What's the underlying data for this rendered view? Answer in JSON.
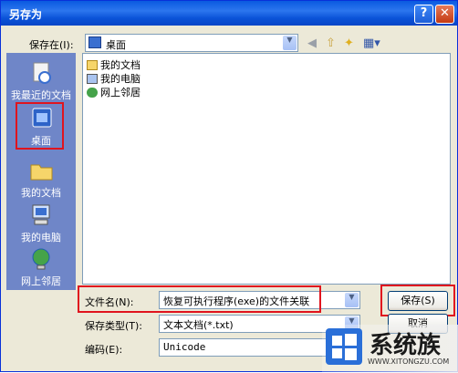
{
  "window": {
    "title": "另存为",
    "help": "?",
    "close": "✕"
  },
  "savein": {
    "label": "保存在(I):",
    "value": "桌面"
  },
  "places": [
    {
      "label": "我最近的文档",
      "icon": "recent-documents-icon"
    },
    {
      "label": "桌面",
      "icon": "desktop-icon"
    },
    {
      "label": "我的文档",
      "icon": "my-documents-icon"
    },
    {
      "label": "我的电脑",
      "icon": "my-computer-icon"
    },
    {
      "label": "网上邻居",
      "icon": "network-places-icon"
    }
  ],
  "files": [
    {
      "label": "我的文档",
      "icon": "folder-icon"
    },
    {
      "label": "我的电脑",
      "icon": "computer-icon"
    },
    {
      "label": "网上邻居",
      "icon": "network-icon"
    }
  ],
  "form": {
    "filename_label": "文件名(N):",
    "filename_value": "恢复可执行程序(exe)的文件关联",
    "type_label": "保存类型(T):",
    "type_value": "文本文档(*.txt)",
    "encoding_label": "编码(E):",
    "encoding_value": "Unicode"
  },
  "buttons": {
    "save": "保存(S)",
    "cancel": "取消"
  },
  "watermark": {
    "text": "系统族",
    "url": "WWW.XITONGZU.COM"
  },
  "colors": {
    "highlight": "#e0141e",
    "title_blue": "#0a5ae0",
    "places_bg": "#6f86c8"
  }
}
